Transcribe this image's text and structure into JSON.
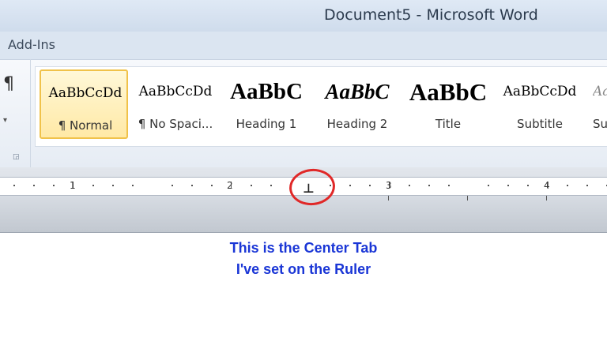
{
  "window": {
    "title": "Document5  -  Microsoft Word"
  },
  "ribbon": {
    "tab_addins": "Add-Ins",
    "paragraph_mark": "¶",
    "styles": [
      {
        "preview": "AaBbCcDd",
        "label": "¶ Normal",
        "selected": true
      },
      {
        "preview": "AaBbCcDd",
        "label": "¶ No Spaci..."
      },
      {
        "preview": "AaBbC",
        "label": "Heading 1"
      },
      {
        "preview": "AaBbC",
        "label": "Heading 2"
      },
      {
        "preview": "AaBbC",
        "label": "Title"
      },
      {
        "preview": "AaBbCcDd",
        "label": "Subtitle"
      },
      {
        "preview": "AaBbCcDd",
        "label": "Su"
      }
    ]
  },
  "ruler": {
    "numbers": [
      "1",
      "2",
      "3",
      "4"
    ],
    "tab_symbol": "⊥"
  },
  "annotation": {
    "line1": "This is the Center Tab",
    "line2": "I've set on the Ruler",
    "color": "#1a36d6",
    "circle_color": "#e02828"
  }
}
